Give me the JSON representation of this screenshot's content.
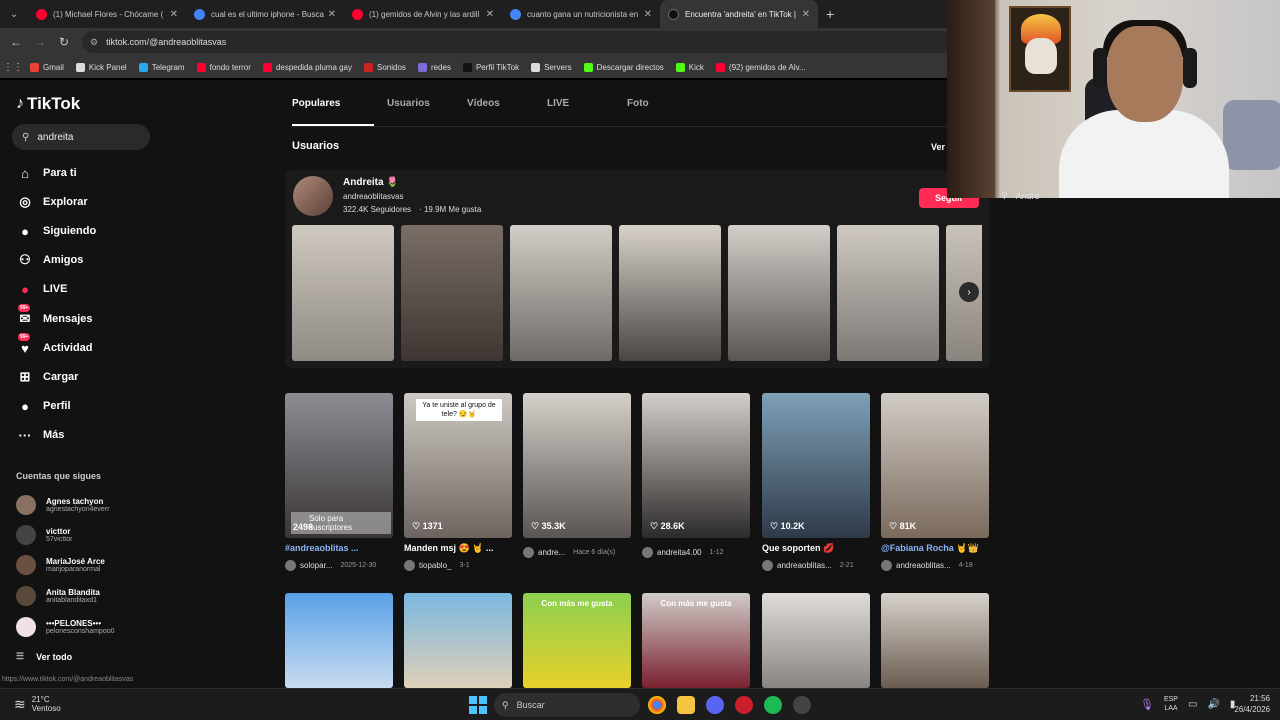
{
  "browser": {
    "tabs": [
      {
        "title": "(1) Michael Flores - Chócame (",
        "color": "#ff0033"
      },
      {
        "title": "cual es el ultimo iphone - Busca",
        "color": "#4285f4"
      },
      {
        "title": "(1) gemidos de Alvin y las ardill",
        "color": "#ff0033"
      },
      {
        "title": "cuanto gana un nutricionista en",
        "color": "#4285f4"
      },
      {
        "title": "Encuentra 'andreita' en TikTok |",
        "color": "#111111"
      }
    ],
    "url": "tiktok.com/@andreaoblitasvas",
    "bookmarks": [
      {
        "label": "Gmail",
        "color": "#ea4335"
      },
      {
        "label": "Kick Panel",
        "color": "#dddddd"
      },
      {
        "label": "Telegram",
        "color": "#29a9eb"
      },
      {
        "label": "fondo terror",
        "color": "#ff0033"
      },
      {
        "label": "despedida pluma gay",
        "color": "#ff0033"
      },
      {
        "label": "Sonidos",
        "color": "#cc2222"
      },
      {
        "label": "redes",
        "color": "#7c6cd6"
      },
      {
        "label": "Perfil TikTok",
        "color": "#111111"
      },
      {
        "label": "Servers",
        "color": "#dddddd"
      },
      {
        "label": "Descargar directos",
        "color": "#53fc18"
      },
      {
        "label": "Kick",
        "color": "#53fc18"
      },
      {
        "label": "(92) gemidos de Alv...",
        "color": "#ff0033"
      }
    ],
    "status_url": "https://www.tiktok.com/@andreaoblitasvas"
  },
  "sidebar": {
    "logo": "TikTok",
    "search_value": "andreita",
    "nav": [
      {
        "label": "Para ti",
        "icon": "home-icon"
      },
      {
        "label": "Explorar",
        "icon": "compass-icon"
      },
      {
        "label": "Siguiendo",
        "icon": "following-icon"
      },
      {
        "label": "Amigos",
        "icon": "friends-icon"
      },
      {
        "label": "LIVE",
        "icon": "live-icon"
      },
      {
        "label": "Mensajes",
        "icon": "messages-icon",
        "badge": "99+"
      },
      {
        "label": "Actividad",
        "icon": "activity-icon",
        "badge": "99+"
      },
      {
        "label": "Cargar",
        "icon": "upload-icon"
      },
      {
        "label": "Perfil",
        "icon": "profile-icon"
      },
      {
        "label": "Más",
        "icon": "more-icon"
      }
    ],
    "following_title": "Cuentas que sigues",
    "following": [
      {
        "name": "Agnes tachyon",
        "handle": "agnestachyon4everr"
      },
      {
        "name": "victtor",
        "handle": "57victtor"
      },
      {
        "name": "MaríaJosé Arce",
        "handle": "marijoparanormal"
      },
      {
        "name": "Anita Blandita",
        "handle": "anitablanditaxd1"
      },
      {
        "name": "•••PELONES•••",
        "handle": "pelonesconshampoo0"
      }
    ],
    "see_all": "Ver todo"
  },
  "main": {
    "tabs": [
      "Populares",
      "Usuarios",
      "Vídeos",
      "LIVE",
      "Foto"
    ],
    "section_title": "Usuarios",
    "see_more": "Ver",
    "user": {
      "name": "Andreita",
      "handle": "andreaoblitasvas",
      "followers": "322.4K Seguidores",
      "likes": "19.9M Me gusta",
      "follow_label": "Seguir"
    },
    "videos": [
      {
        "stat": "2498",
        "pill": "Solo para suscriptores",
        "title": "#andreaoblitas ...",
        "title_blue": true,
        "author": "solopar...",
        "date": "2025-12-30"
      },
      {
        "stat": "1371",
        "caption": "Ya te uniste al grupo de tele? 😏🤘",
        "title": "Manden msj 😍 🤘 ...",
        "author": "tiopablo_",
        "date": "3-1"
      },
      {
        "stat": "35.3K",
        "title": "",
        "author": "andre...",
        "date": "Hace 6 día(s)"
      },
      {
        "stat": "28.6K",
        "title": "",
        "author": "andreita4.00",
        "date": "1-12"
      },
      {
        "stat": "10.2K",
        "title": "Que soporten 💋",
        "author": "andreaoblitas...",
        "date": "2-21"
      },
      {
        "stat": "81K",
        "title": "@Fabiana Rocha 🤘👑",
        "title_blue": true,
        "author": "andreaoblitas...",
        "date": "4-18"
      }
    ],
    "videos_row2_tags": [
      "",
      "",
      "Con más me gusta",
      "Con más me gusta",
      "",
      ""
    ]
  },
  "taskbar": {
    "weather_temp": "21°C",
    "weather_text": "Ventoso",
    "search": "Buscar",
    "lang1": "ESP",
    "lang2": "LAA",
    "time": "21:56",
    "date": "26/4/2026"
  },
  "overlay": {
    "search_text": "Andre"
  }
}
